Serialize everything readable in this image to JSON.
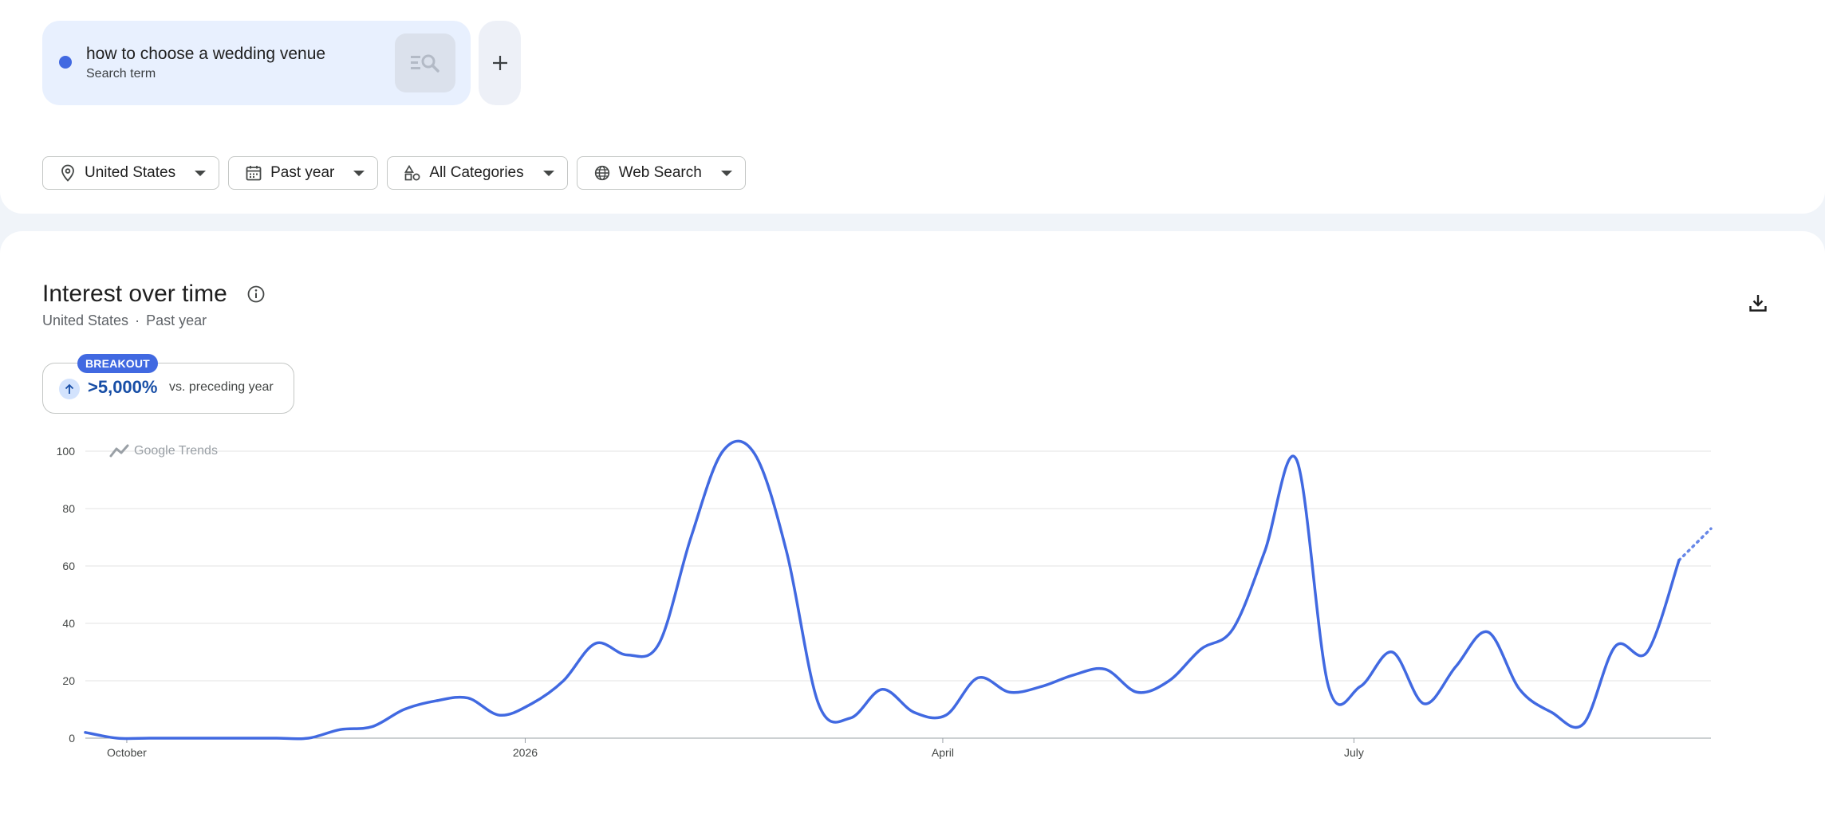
{
  "search_term": {
    "text": "how to choose a wedding venue",
    "type_label": "Search term",
    "color": "#4169e1"
  },
  "filters": {
    "region": "United States",
    "time": "Past year",
    "category": "All Categories",
    "property": "Web Search"
  },
  "card": {
    "title": "Interest over time",
    "subtitle_region": "United States",
    "subtitle_sep": "·",
    "subtitle_time": "Past year",
    "breakout_badge": "BREAKOUT",
    "breakout_value": ">5,000%",
    "breakout_text": "vs. preceding year"
  },
  "chart_data": {
    "type": "line",
    "watermark": "Google Trends",
    "ylim": [
      0,
      100
    ],
    "yticks": [
      0,
      20,
      40,
      60,
      80,
      100
    ],
    "xticks": [
      {
        "label": "October",
        "week": 1.3
      },
      {
        "label": "2026",
        "week": 13.8
      },
      {
        "label": "April",
        "week": 26.9
      },
      {
        "label": "July",
        "week": 39.8
      }
    ],
    "grid": true,
    "series": [
      {
        "color": "#4169e1",
        "values": [
          2,
          0,
          0,
          0,
          0,
          0,
          0,
          0,
          3,
          4,
          10,
          13,
          14,
          8,
          12,
          20,
          33,
          29,
          33,
          70,
          100,
          99,
          65,
          12,
          7,
          17,
          9,
          8,
          21,
          16,
          18,
          22,
          24,
          16,
          20,
          31,
          38,
          65,
          97,
          18,
          18,
          30,
          12,
          25,
          37,
          17,
          9,
          5,
          32,
          30,
          62
        ],
        "partial_values": [
          62,
          73
        ]
      }
    ]
  }
}
